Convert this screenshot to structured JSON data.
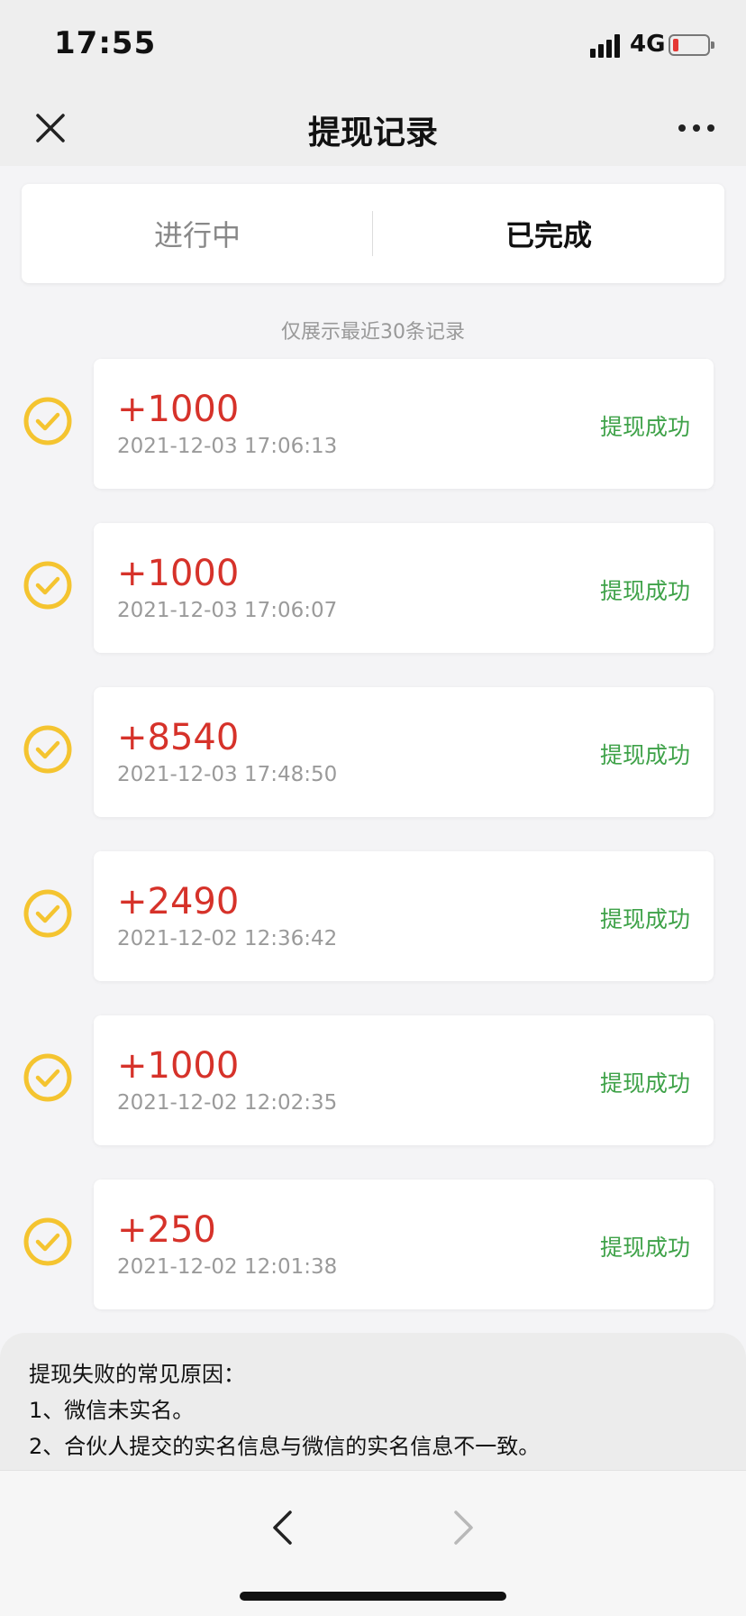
{
  "status_bar": {
    "time": "17:55",
    "network": "4G",
    "battery_color": "#e53935"
  },
  "nav": {
    "title": "提现记录",
    "close_icon": "close-icon",
    "more_icon": "more-icon"
  },
  "tabs": [
    {
      "label": "进行中",
      "active": false
    },
    {
      "label": "已完成",
      "active": true
    }
  ],
  "hint": "仅展示最近30条记录",
  "records": [
    {
      "amount": "+1000",
      "time": "2021-12-03 17:06:13",
      "status": "提现成功"
    },
    {
      "amount": "+1000",
      "time": "2021-12-03 17:06:07",
      "status": "提现成功"
    },
    {
      "amount": "+8540",
      "time": "2021-12-03 17:48:50",
      "status": "提现成功"
    },
    {
      "amount": "+2490",
      "time": "2021-12-02 12:36:42",
      "status": "提现成功"
    },
    {
      "amount": "+1000",
      "time": "2021-12-02 12:02:35",
      "status": "提现成功"
    },
    {
      "amount": "+250",
      "time": "2021-12-02 12:01:38",
      "status": "提现成功"
    }
  ],
  "reasons": {
    "title": "提现失败的常见原因：",
    "items": [
      "1、微信未实名。",
      "2、合伙人提交的实名信息与微信的实名信息不一致。"
    ]
  },
  "colors": {
    "amount": "#d6322a",
    "success": "#3fa249",
    "check": "#f4c430"
  }
}
